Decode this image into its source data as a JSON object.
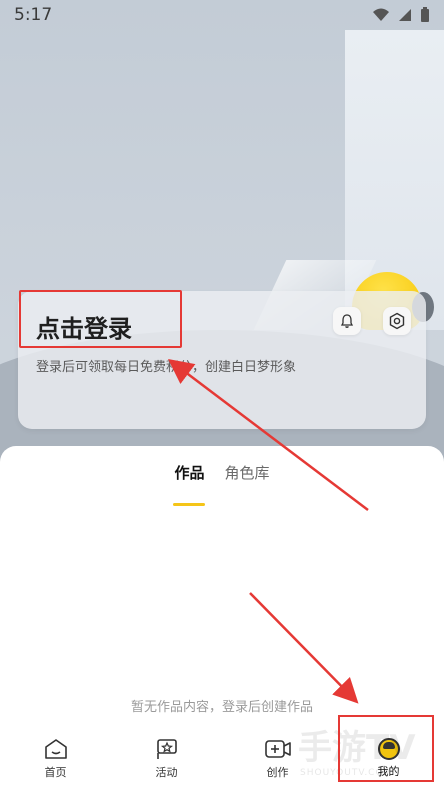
{
  "status": {
    "time": "5:17",
    "wifi_icon": "wifi-icon",
    "signal_icon": "signal-icon",
    "battery_icon": "battery-icon"
  },
  "profile": {
    "login_title": "点击登录",
    "login_subtitle": "登录后可领取每日免费积分，创建白日梦形象",
    "bell_icon": "bell-icon",
    "settings_icon": "settings-icon"
  },
  "tabs": [
    {
      "label": "作品",
      "active": true
    },
    {
      "label": "角色库",
      "active": false
    }
  ],
  "empty_state": "暂无作品内容，登录后创建作品",
  "nav": [
    {
      "label": "首页",
      "icon": "home-icon"
    },
    {
      "label": "活动",
      "icon": "activity-flag-icon"
    },
    {
      "label": "创作",
      "icon": "create-video-icon"
    },
    {
      "label": "我的",
      "icon": "avatar-icon",
      "active": true
    }
  ],
  "watermark": {
    "main": "手游TV",
    "sub": "SHOUYOUTV.COM"
  },
  "colors": {
    "accent": "#f5c518",
    "annotation": "#e53935"
  }
}
